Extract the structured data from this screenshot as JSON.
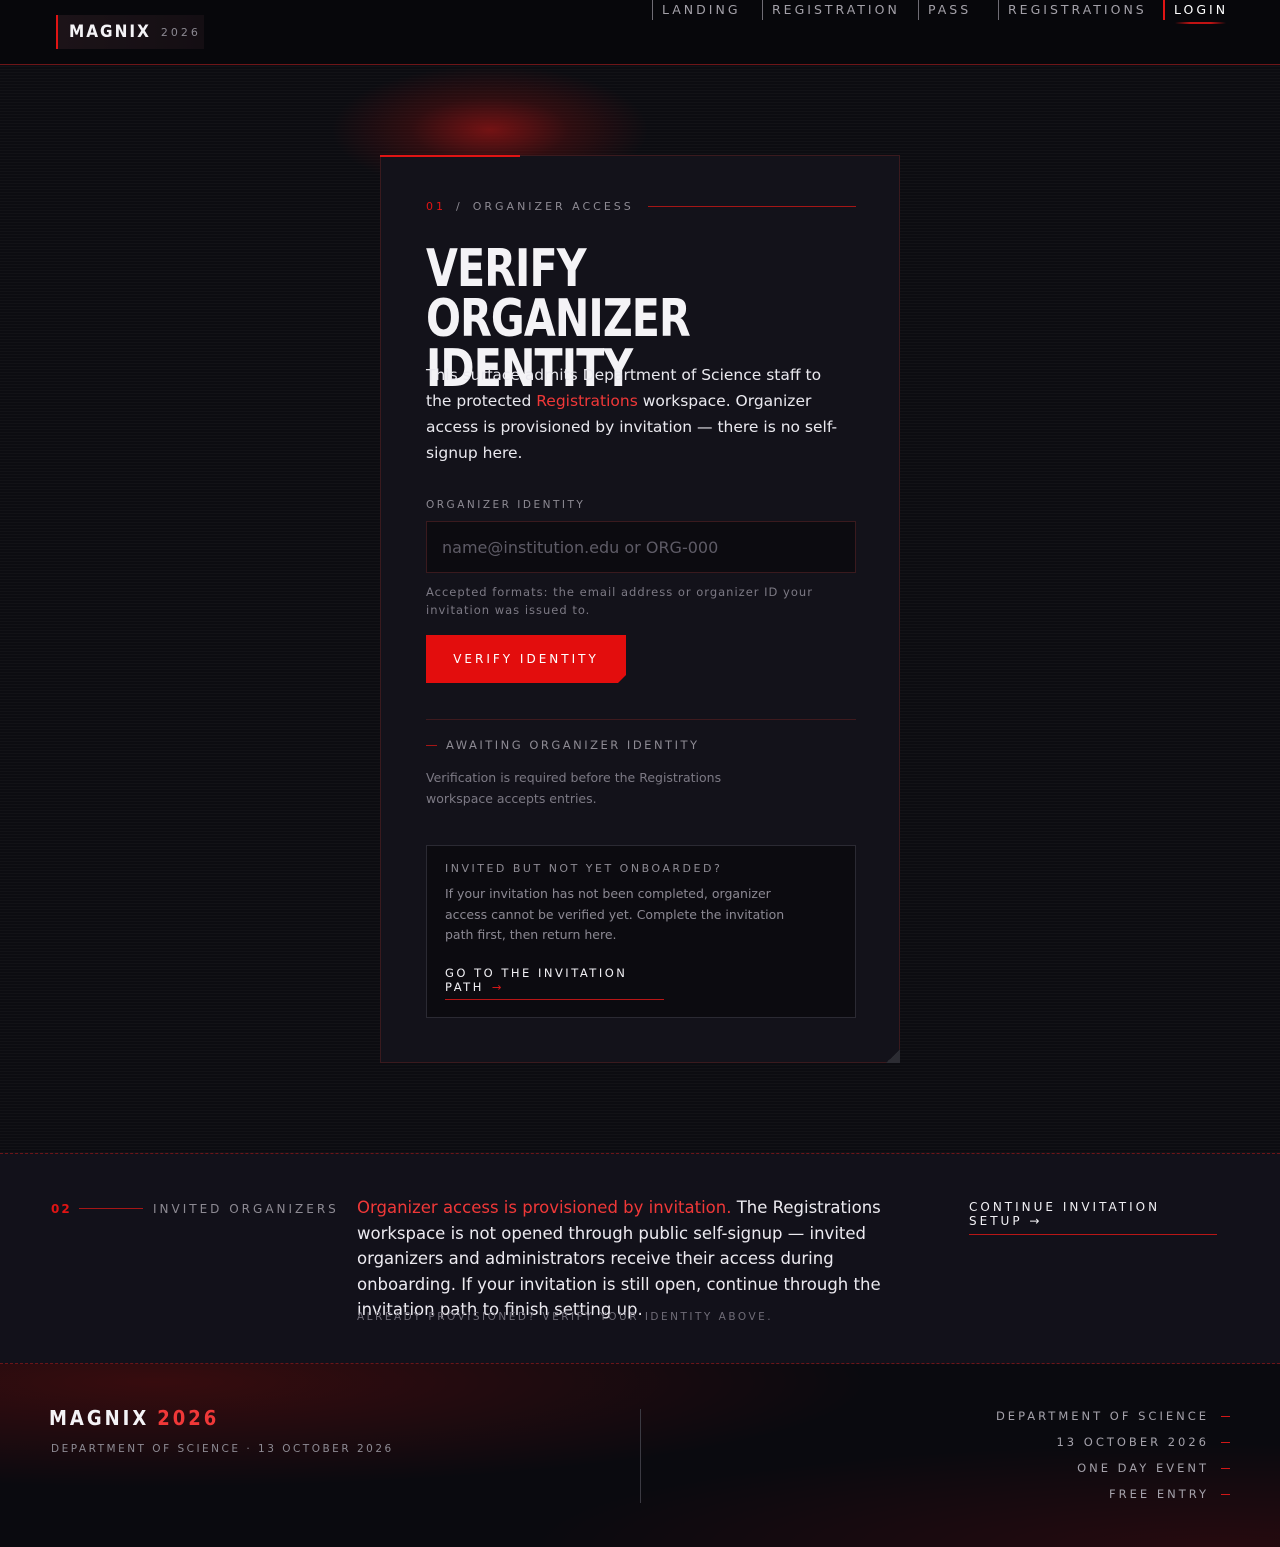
{
  "header": {
    "brand_name": "MAGNIX",
    "brand_year": "2026",
    "nav": [
      {
        "label": "LANDING"
      },
      {
        "label": "REGISTRATION"
      },
      {
        "label": "PASS"
      },
      {
        "label": "REGISTRATIONS"
      },
      {
        "label": "LOGIN",
        "active": true
      }
    ]
  },
  "card": {
    "eyebrow_num": "01",
    "eyebrow_sep": "/",
    "eyebrow_label": "ORGANIZER ACCESS",
    "title": "VERIFY ORGANIZER IDENTITY",
    "desc_before": "This surface admits Department of Science staff to the protected ",
    "desc_link": "Registrations",
    "desc_after": " workspace. Organizer access is provisioned by invitation — there is no self-signup here.",
    "field_label": "ORGANIZER IDENTITY",
    "field_value": "",
    "field_placeholder": "name@institution.edu or ORG-000",
    "field_help": "Accepted formats: the email address or organizer ID your invitation was issued to.",
    "verify_button": "VERIFY IDENTITY",
    "status": "AWAITING ORGANIZER IDENTITY",
    "status_note": "Verification is required before the Registrations workspace accepts entries.",
    "invite": {
      "heading": "INVITED BUT NOT YET ONBOARDED?",
      "text": "If your invitation has not been completed, organizer access cannot be verified yet. Complete the invitation path first, then return here.",
      "link": "GO TO THE INVITATION PATH",
      "link_arrow": "→"
    }
  },
  "section2": {
    "num": "02",
    "label": "INVITED ORGANIZERS",
    "highlight": "Organizer access is provisioned by invitation.",
    "body": " The Registrations workspace is not opened through public self-signup — invited organizers and administrators receive their access during onboarding. If your invitation is still open, continue through the invitation path to finish setting up.",
    "small": "ALREADY PROVISIONED? VERIFY YOUR IDENTITY ABOVE.",
    "cta": "CONTINUE INVITATION SETUP →"
  },
  "footer": {
    "brand": "MAGNIX",
    "year": "2026",
    "sub": "DEPARTMENT OF SCIENCE · 13 OCTOBER 2026",
    "items": [
      "DEPARTMENT OF SCIENCE",
      "13 OCTOBER 2026",
      "ONE DAY EVENT",
      "FREE ENTRY"
    ]
  },
  "colors": {
    "accent": "#e01414",
    "background": "#0b0b10",
    "card": "#13121a",
    "text": "#ecebf0"
  }
}
